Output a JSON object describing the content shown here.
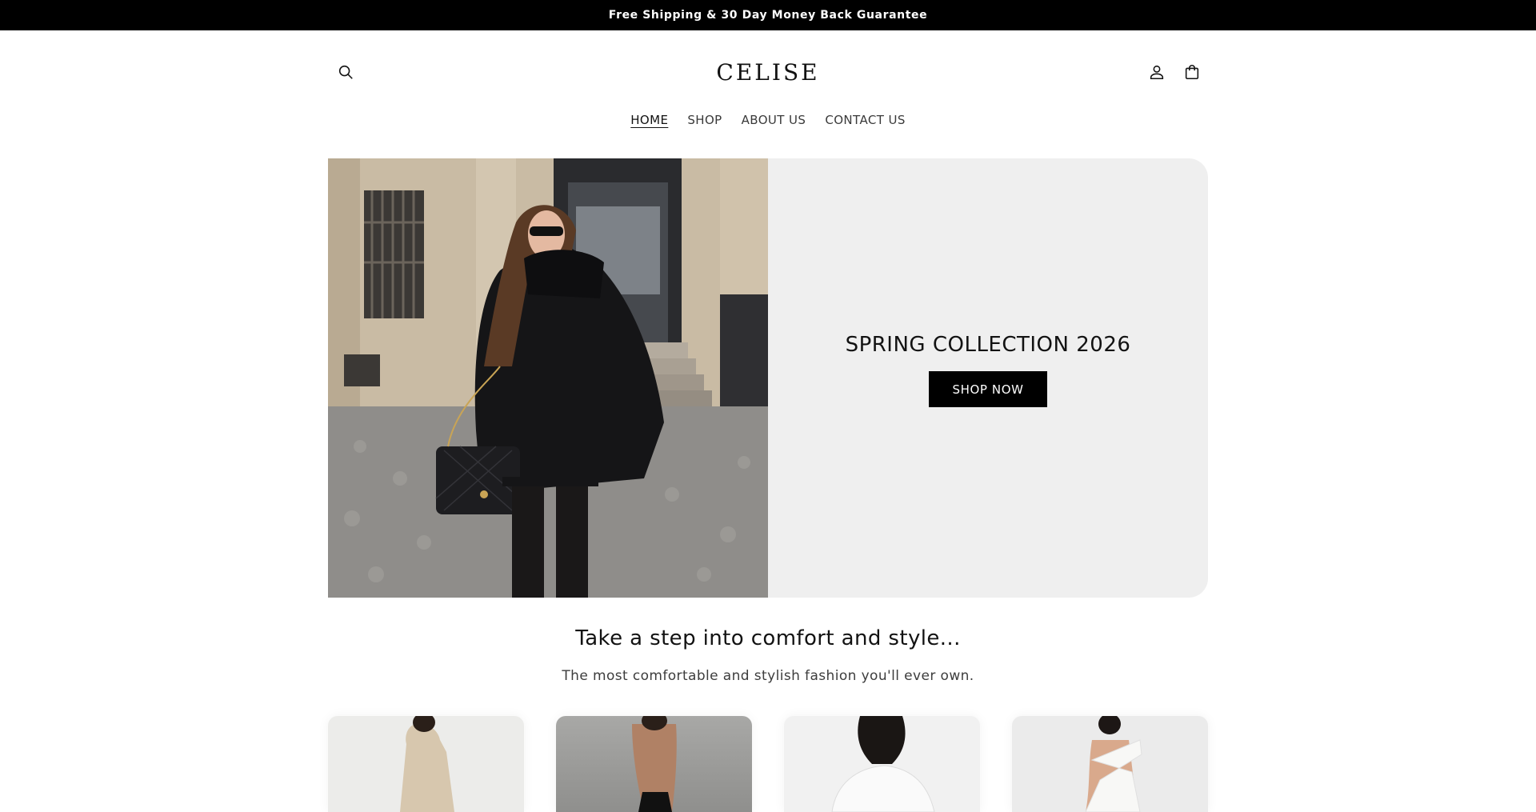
{
  "announcement": {
    "text": "Free Shipping & 30 Day Money Back Guarantee"
  },
  "header": {
    "logo": "CELISE",
    "icons": {
      "search": "search-icon",
      "account": "user-icon",
      "cart": "shopping-bag-icon"
    }
  },
  "nav": {
    "items": [
      {
        "label": "HOME",
        "active": true
      },
      {
        "label": "SHOP",
        "active": false
      },
      {
        "label": "ABOUT US",
        "active": false
      },
      {
        "label": "CONTACT US",
        "active": false
      }
    ]
  },
  "hero": {
    "image_alt": "Woman in black oversized coat with quilted handbag on a Paris street",
    "title": "SPRING COLLECTION 2026",
    "button": "SHOP NOW"
  },
  "intro": {
    "heading": "Take a step into comfort and style...",
    "subheading": "The most comfortable and stylish fashion you'll ever own."
  },
  "products": [
    {
      "image": "beige one-shoulder dress"
    },
    {
      "image": "black backless dress"
    },
    {
      "image": "white off-shoulder top"
    },
    {
      "image": "white cut-out dress"
    }
  ],
  "colors": {
    "accent": "#000000",
    "panel": "#efefef"
  }
}
